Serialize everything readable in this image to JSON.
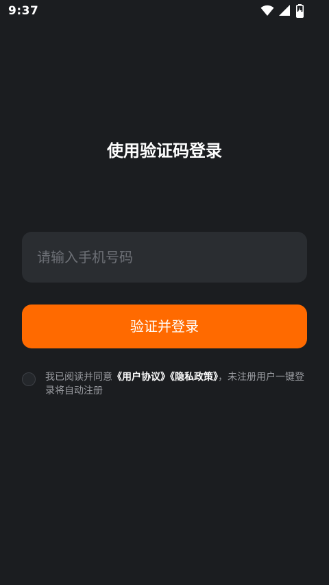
{
  "status_bar": {
    "time": "9:37",
    "icons": [
      "wifi-icon",
      "signal-icon",
      "battery-charging-icon"
    ]
  },
  "title": "使用验证码登录",
  "phone_input": {
    "placeholder": "请输入手机号码",
    "value": ""
  },
  "submit_label": "验证并登录",
  "agreement": {
    "checked": false,
    "prefix": "我已阅读并同意",
    "user_agreement": "《用户协议》",
    "privacy_policy": "《隐私政策》",
    "suffix": "，未注册用户一键登录将自动注册"
  },
  "colors": {
    "background": "#1b1d20",
    "input_background": "#2a2d31",
    "accent": "#ff6a00",
    "muted_text": "#9a9ca1",
    "placeholder": "#6d7076"
  }
}
